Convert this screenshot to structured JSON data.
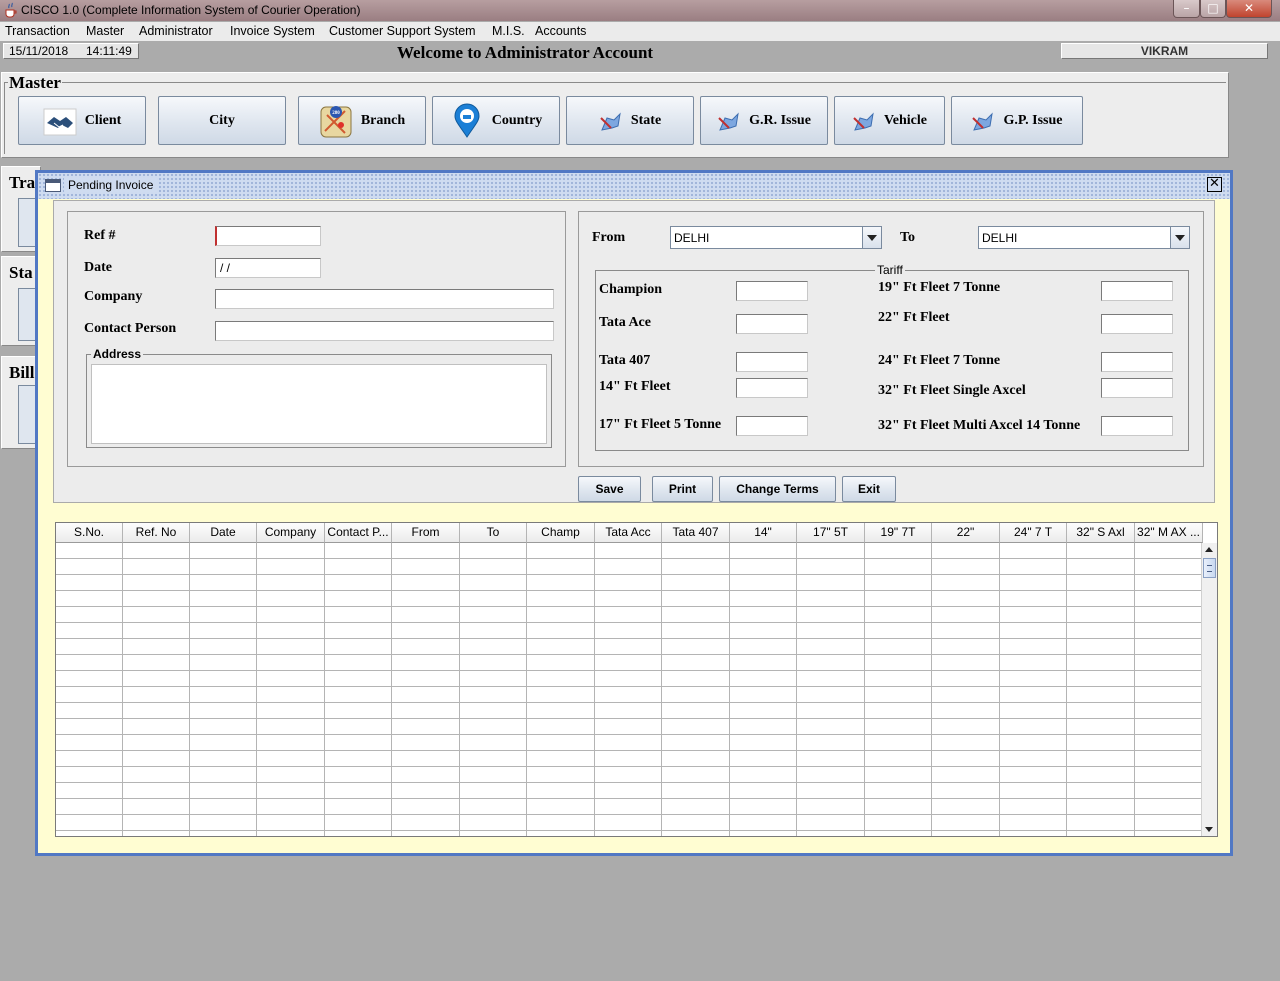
{
  "window": {
    "title": "CISCO 1.0 (Complete Information System of Courier Operation)",
    "minimize": "–",
    "maximize": "□",
    "close": "✕"
  },
  "menu": [
    "Transaction",
    "Master",
    "Administrator",
    "Invoice System",
    "Customer Support System",
    "M.I.S.",
    "Accounts"
  ],
  "status": {
    "date": "15/11/2018",
    "time": "14:11:49",
    "welcome": "Welcome to Administrator Account",
    "user": "VIKRAM"
  },
  "master": {
    "heading": "Master",
    "buttons": [
      "Client",
      "City",
      "Branch",
      "Country",
      "State",
      "G.R. Issue",
      "Vehicle",
      "G.P. Issue"
    ]
  },
  "side_headings": [
    "Tra",
    "Sta",
    "Bill"
  ],
  "dialog": {
    "title": "Pending Invoice",
    "close": "✕",
    "ref_label": "Ref #",
    "ref_value": "",
    "date_label": "Date",
    "date_value": " / /",
    "company_label": "Company",
    "company_value": "",
    "contact_label": "Contact Person",
    "contact_value": "",
    "address_label": "Address",
    "address_value": "",
    "from_label": "From",
    "from_value": "DELHI",
    "to_label": "To",
    "to_value": "DELHI",
    "tariff_label": "Tariff",
    "tariff_left": [
      "Champion",
      "Tata Ace",
      "Tata 407",
      "14\" Ft Fleet",
      "17\" Ft Fleet 5 Tonne"
    ],
    "tariff_right": [
      "19\" Ft Fleet 7 Tonne",
      "22\" Ft Fleet",
      "24\" Ft Fleet 7 Tonne",
      "32\" Ft Fleet Single Axcel",
      "32\" Ft Fleet Multi Axcel 14 Tonne"
    ],
    "buttons": {
      "save": "Save",
      "print": "Print",
      "change_terms": "Change Terms",
      "exit": "Exit"
    },
    "table": {
      "columns": [
        "S.No.",
        "Ref. No",
        "Date",
        "Company",
        "Contact P...",
        "From",
        "To",
        "Champ",
        "Tata Acc",
        "Tata 407",
        "14\"",
        "17\" 5T",
        "19\" 7T",
        "22\"",
        "24\" 7 T",
        "32\" S Axl",
        "32\" M AX ..."
      ],
      "rows": []
    }
  }
}
